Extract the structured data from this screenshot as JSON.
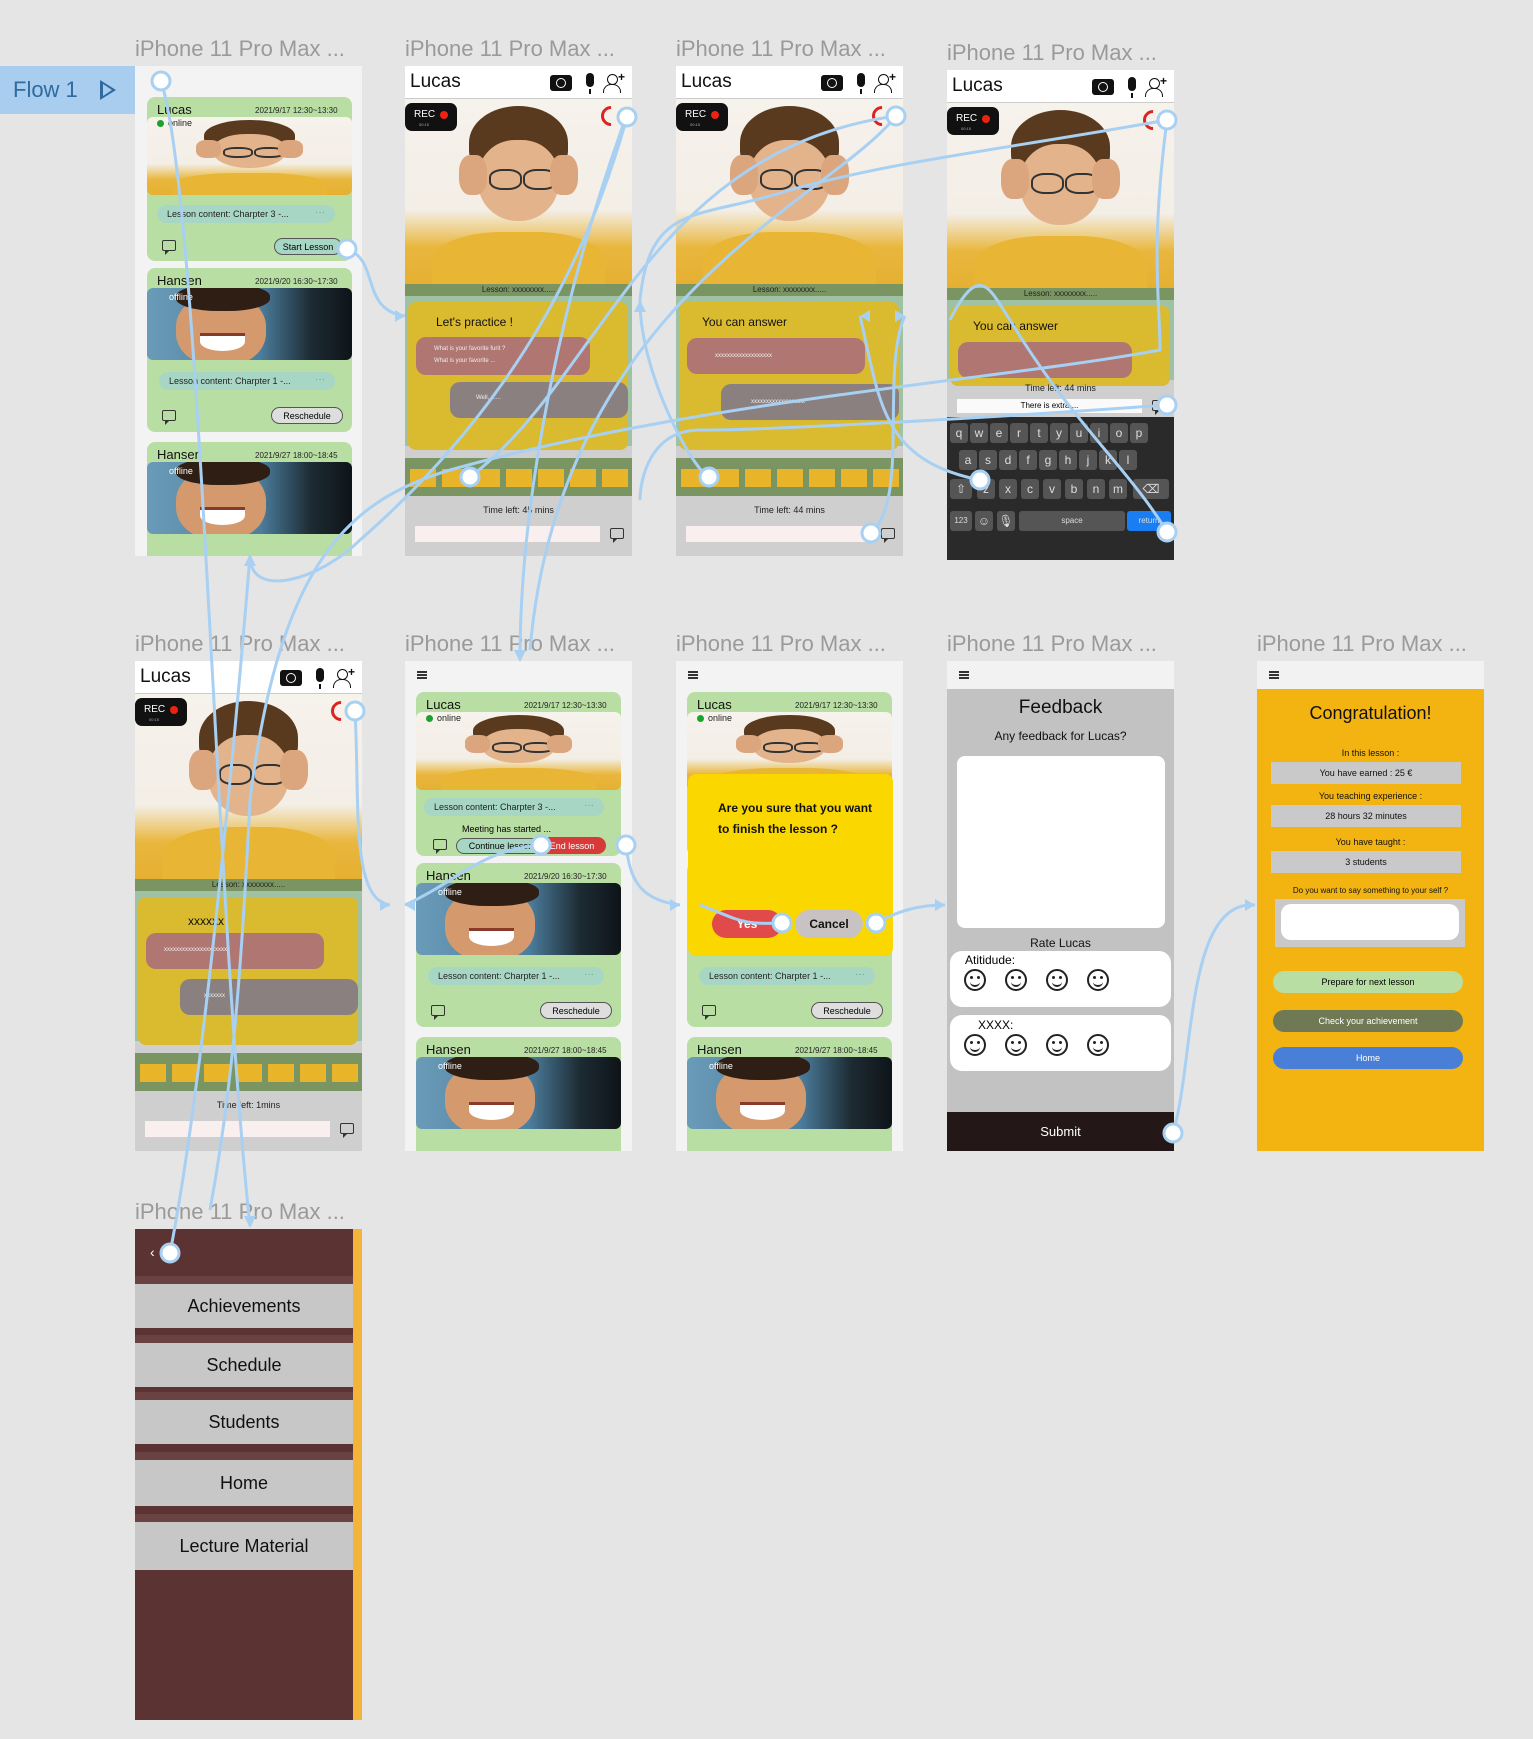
{
  "flow": {
    "label": "Flow 1"
  },
  "frame_title": "iPhone 11 Pro Max ...",
  "cards": {
    "lucas": {
      "name": "Lucas",
      "date": "2021/9/17 12:30~13:30",
      "status": "online",
      "content": "Lesson content: Charpter 3 -...",
      "start_label": "Start Lesson",
      "meeting": "Meeting has started ...",
      "continue_label": "Continue lesson",
      "end_label": "End lesson"
    },
    "hansen1": {
      "name": "Hansen",
      "date": "2021/9/20 16:30~17:30",
      "status": "offline",
      "content": "Lesson content: Charpter 1 -...",
      "reschedule_label": "Reschedule"
    },
    "hansen2": {
      "name": "Hansen",
      "date": "2021/9/27 18:00~18:45",
      "status": "offline",
      "content": "Lesson content: Charpter 1 -..."
    },
    "more": "···"
  },
  "call": {
    "name": "Lucas",
    "rec_label": "REC",
    "rec_time": "00:15",
    "lesson_bar": "Lesson: xxxxxxxx.....",
    "practice_title": "Let's practice !",
    "q1": "What is your favorite furit ?",
    "q2": "What is your favorite ...",
    "answer_hint": "Well, ......",
    "answer_title": "You can answer",
    "answer_placeholder": "xxxxxxxxxxxxxxxxxxx",
    "answer_reply": "xxxxxxxxxxxxxxxxxx",
    "time_left_1": "Time left: 45 mins",
    "time_left_2": "Time left: 44 mins",
    "time_left_3": "Time left: 44 mins",
    "time_left_4": "Time left: 1mins",
    "typed_text": "There is extra ...",
    "last_title": "xxxxxx",
    "last_bubble": "xxxxxxxxxxxxxxxxxxxxx",
    "last_reply": "xxxxxxx"
  },
  "keyboard": {
    "row1": [
      "q",
      "w",
      "e",
      "r",
      "t",
      "y",
      "u",
      "i",
      "o",
      "p"
    ],
    "row2": [
      "a",
      "s",
      "d",
      "f",
      "g",
      "h",
      "j",
      "k",
      "l"
    ],
    "row3": [
      "z",
      "x",
      "c",
      "v",
      "b",
      "n",
      "m"
    ],
    "num": "123",
    "space": "space",
    "return": "return"
  },
  "confirm": {
    "question": "Are you sure that you want to finish the lesson ?",
    "yes": "Yes",
    "cancel": "Cancel"
  },
  "feedback": {
    "title": "Feedback",
    "subtitle": "Any feedback for Lucas?",
    "rate": "Rate Lucas",
    "cat1": "Atitidude:",
    "cat2": "XXXX:",
    "submit": "Submit"
  },
  "congrats": {
    "title": "Congratulation!",
    "in_lesson": "In this lesson :",
    "earned": "You have earned : 25 €",
    "exp_label": "You teaching experience :",
    "exp_value": "28 hours 32 minutes",
    "taught_label": "You have taught :",
    "taught_value": "3 students",
    "say_label": "Do you want to say something to your self ?",
    "btn_prepare": "Prepare for next lesson",
    "btn_achievement": "Check your achievement",
    "btn_home": "Home"
  },
  "menu": {
    "items": [
      "Achievements",
      "Schedule",
      "Students",
      "Home",
      "Lecture Material"
    ]
  },
  "colors": {
    "card": "#b9dea3",
    "practice": "#daba2e",
    "congrats": "#f3b412",
    "menu": "#5b3333",
    "wire": "#a8d0f2"
  }
}
